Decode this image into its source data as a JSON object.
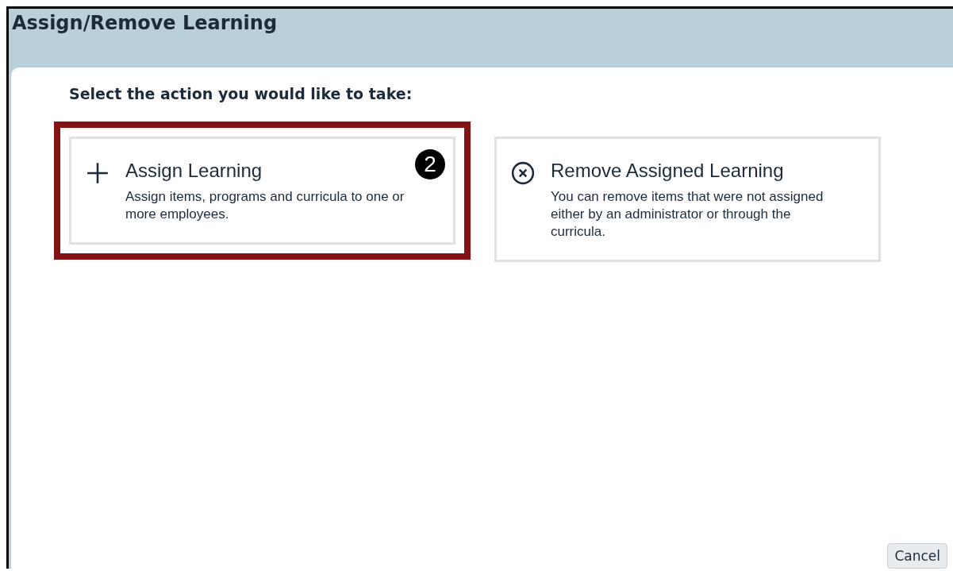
{
  "window": {
    "title": "Assign/Remove Learning"
  },
  "prompt": "Select the action you would like to take:",
  "options": [
    {
      "kind": "add",
      "title": "Assign Learning",
      "description": "Assign items, programs and curricula to one or more employees.",
      "highlighted": true,
      "step": "2"
    },
    {
      "kind": "remove",
      "title": "Remove Assigned Learning",
      "description": "You can remove items that were not assigned either by an administrator or through the curricula.",
      "highlighted": false
    }
  ],
  "buttons": [
    {
      "label": "Cancel"
    }
  ]
}
